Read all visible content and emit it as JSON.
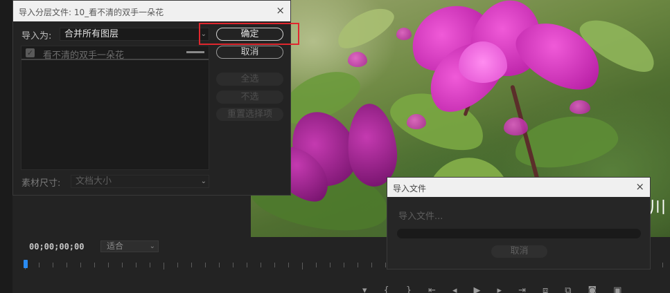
{
  "import_dialog": {
    "title": "导入分层文件: 10_看不清的双手一朵花",
    "close_icon": "×",
    "import_as_label": "导入为:",
    "import_as_value": "合并所有图层",
    "layers": [
      {
        "name": "看不清的双手一朵花",
        "checked": true
      }
    ],
    "footage_size_label": "素材尺寸:",
    "footage_size_value": "文档大小",
    "buttons": {
      "ok": "确定",
      "cancel": "取消",
      "select_all": "全选",
      "select_none": "不选",
      "reset_selection": "重置选择项"
    }
  },
  "progress_dialog": {
    "title": "导入文件",
    "close_icon": "×",
    "status": "导入文件...",
    "progress": 0,
    "cancel": "取消"
  },
  "timeline": {
    "timecode": "00;00;00;00",
    "zoom_value": "适合"
  },
  "photo": {
    "overlay_text": "川"
  },
  "colors": {
    "highlight": "#e0272e",
    "playhead": "#2a8bf2",
    "flower_magenta": "#e04fd0"
  }
}
